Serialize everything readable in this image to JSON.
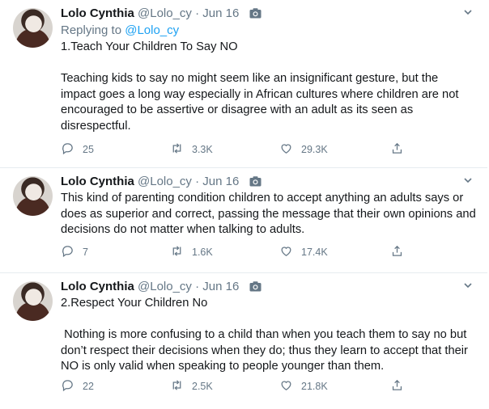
{
  "tweets": [
    {
      "name": "Lolo Cynthia",
      "handle": "@Lolo_cy",
      "separator": "·",
      "date": "Jun 16",
      "replying_prefix": "Replying to ",
      "replying_handle": "@Lolo_cy",
      "text": "1.Teach Your Children To Say NO\n\nTeaching kids to say no might seem like an insignificant gesture, but the impact goes a long way especially in African cultures where children are not encouraged to be assertive or disagree with an adult as its seen as disrespectful.",
      "replies": "25",
      "retweets": "3.3K",
      "likes": "29.3K"
    },
    {
      "name": "Lolo Cynthia",
      "handle": "@Lolo_cy",
      "separator": "·",
      "date": "Jun 16",
      "text": "This kind of parenting condition children to accept anything an adults says or does as superior and correct, passing the message that their own opinions and decisions do not matter when talking to adults.",
      "replies": "7",
      "retweets": "1.6K",
      "likes": "17.4K"
    },
    {
      "name": "Lolo Cynthia",
      "handle": "@Lolo_cy",
      "separator": "·",
      "date": "Jun 16",
      "text": "2.Respect Your Children No\n\n Nothing is more confusing to a child than when you teach them to say no but don’t respect their decisions when they do; thus they learn to accept that their NO is only valid when speaking to people younger than them.",
      "replies": "22",
      "retweets": "2.5K",
      "likes": "21.8K"
    }
  ],
  "icons": [
    "camera-icon",
    "chevron-down-icon",
    "reply-icon",
    "retweet-icon",
    "like-icon",
    "share-icon"
  ],
  "colors": {
    "text": "#14171a",
    "muted": "#657786",
    "link": "#1da1f2",
    "border": "#e6ecf0"
  }
}
